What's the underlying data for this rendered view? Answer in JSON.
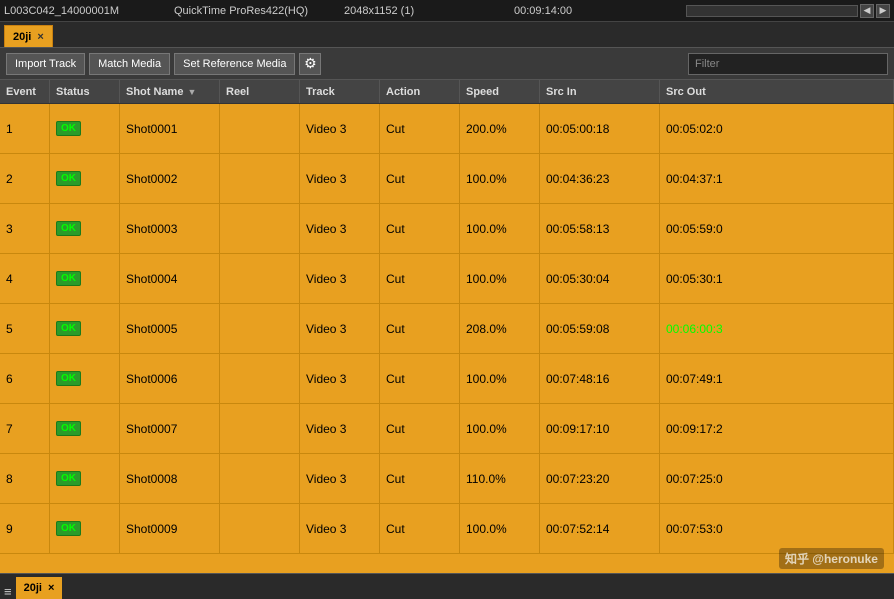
{
  "topbar": {
    "filename": "L003C042_14000001M",
    "codec": "QuickTime ProRes422(HQ)",
    "resolution": "2048x1152 (1)",
    "timecode": "00:09:14:00"
  },
  "tab": {
    "label": "20ji",
    "close": "×"
  },
  "toolbar": {
    "import_track": "Import Track",
    "match_media": "Match Media",
    "set_reference_media": "Set Reference Media",
    "gear": "⚙",
    "filter_placeholder": "Filter"
  },
  "columns": [
    {
      "id": "event",
      "label": "Event"
    },
    {
      "id": "status",
      "label": "Status"
    },
    {
      "id": "shotname",
      "label": "Shot Name",
      "sort": true
    },
    {
      "id": "reel",
      "label": "Reel"
    },
    {
      "id": "track",
      "label": "Track"
    },
    {
      "id": "action",
      "label": "Action"
    },
    {
      "id": "speed",
      "label": "Speed"
    },
    {
      "id": "srcin",
      "label": "Src In"
    },
    {
      "id": "srcout",
      "label": "Src Out"
    }
  ],
  "rows": [
    {
      "event": "1",
      "status": "OK",
      "shotname": "Shot0001",
      "reel": "",
      "track": "Video 3",
      "action": "Cut",
      "speed": "200.0%",
      "srcin": "00:05:00:18",
      "srcout": "00:05:02:0",
      "highlight_out": false
    },
    {
      "event": "2",
      "status": "OK",
      "shotname": "Shot0002",
      "reel": "",
      "track": "Video 3",
      "action": "Cut",
      "speed": "100.0%",
      "srcin": "00:04:36:23",
      "srcout": "00:04:37:1",
      "highlight_out": false
    },
    {
      "event": "3",
      "status": "OK",
      "shotname": "Shot0003",
      "reel": "",
      "track": "Video 3",
      "action": "Cut",
      "speed": "100.0%",
      "srcin": "00:05:58:13",
      "srcout": "00:05:59:0",
      "highlight_out": false
    },
    {
      "event": "4",
      "status": "OK",
      "shotname": "Shot0004",
      "reel": "",
      "track": "Video 3",
      "action": "Cut",
      "speed": "100.0%",
      "srcin": "00:05:30:04",
      "srcout": "00:05:30:1",
      "highlight_out": false
    },
    {
      "event": "5",
      "status": "OK",
      "shotname": "Shot0005",
      "reel": "",
      "track": "Video 3",
      "action": "Cut",
      "speed": "208.0%",
      "srcin": "00:05:59:08",
      "srcout": "00:06:00:3",
      "highlight_out": true
    },
    {
      "event": "6",
      "status": "OK",
      "shotname": "Shot0006",
      "reel": "",
      "track": "Video 3",
      "action": "Cut",
      "speed": "100.0%",
      "srcin": "00:07:48:16",
      "srcout": "00:07:49:1",
      "highlight_out": false
    },
    {
      "event": "7",
      "status": "OK",
      "shotname": "Shot0007",
      "reel": "",
      "track": "Video 3",
      "action": "Cut",
      "speed": "100.0%",
      "srcin": "00:09:17:10",
      "srcout": "00:09:17:2",
      "highlight_out": false
    },
    {
      "event": "8",
      "status": "OK",
      "shotname": "Shot0008",
      "reel": "",
      "track": "Video 3",
      "action": "Cut",
      "speed": "110.0%",
      "srcin": "00:07:23:20",
      "srcout": "00:07:25:0",
      "highlight_out": false
    },
    {
      "event": "9",
      "status": "OK",
      "shotname": "Shot0009",
      "reel": "",
      "track": "Video 3",
      "action": "Cut",
      "speed": "100.0%",
      "srcin": "00:07:52:14",
      "srcout": "00:07:53:0",
      "highlight_out": false
    }
  ],
  "bottom_tab": {
    "label": "20ji",
    "close": "×",
    "icon": "≡"
  },
  "watermark": "知乎 @heronuke"
}
